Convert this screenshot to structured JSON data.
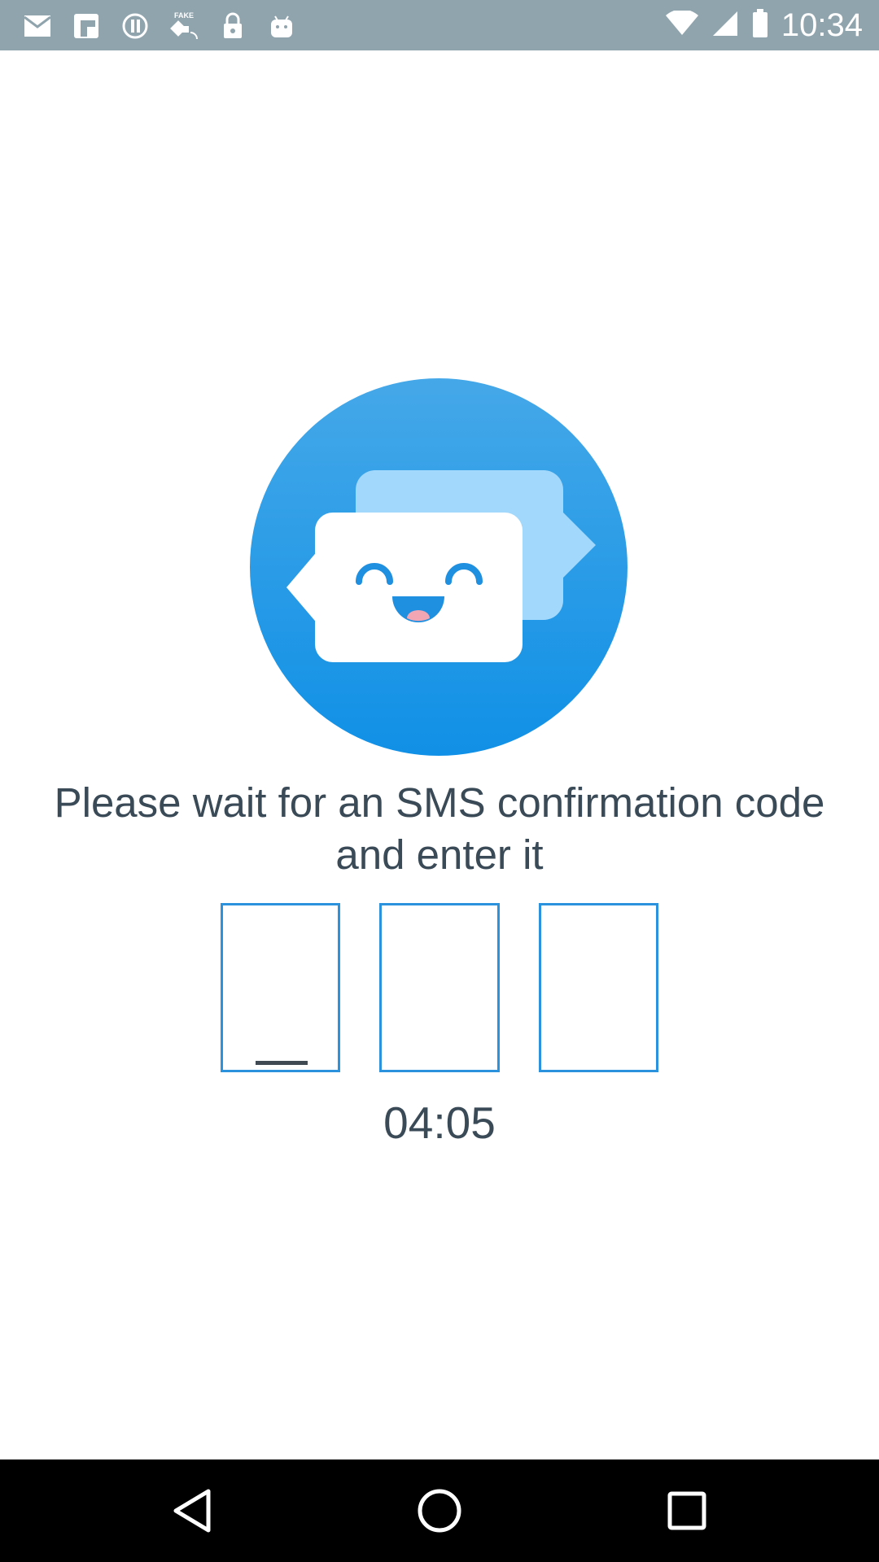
{
  "status_bar": {
    "time": "10:34",
    "left_icons": [
      "mail-icon",
      "flipboard-icon",
      "data-saver-icon",
      "fake-gps-icon",
      "lock-icon",
      "android-icon"
    ],
    "right_icons": [
      "wifi-icon",
      "signal-icon",
      "battery-icon"
    ],
    "fake_gps_label": "FAKE"
  },
  "main": {
    "message": "Please wait for an SMS confirmation code and enter it",
    "code_boxes": [
      "",
      "",
      ""
    ],
    "timer": "04:05"
  },
  "nav_bar": {
    "buttons": [
      "back-icon",
      "home-icon",
      "recents-icon"
    ]
  },
  "colors": {
    "status_bar": "#90a4ae",
    "accent_blue": "#2b92dd",
    "text": "#3a4a57",
    "nav_bar": "#000000"
  }
}
